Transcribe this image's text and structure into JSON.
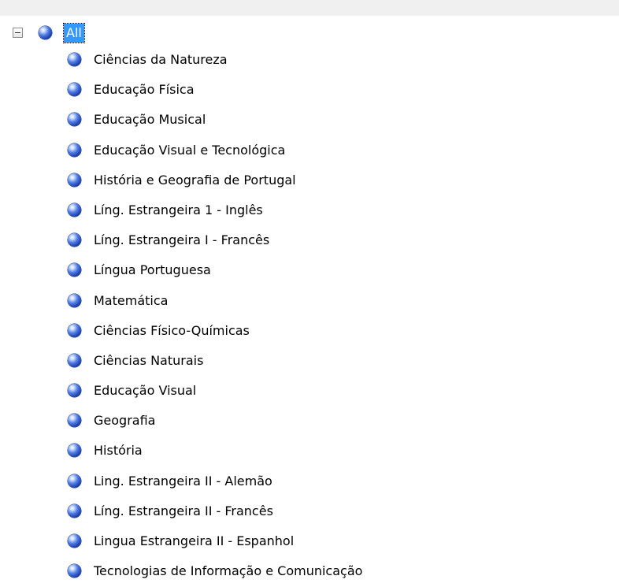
{
  "tree": {
    "root": {
      "label": "All",
      "expanded": true,
      "selected": true,
      "icon": "blue-sphere-icon"
    },
    "children": [
      {
        "label": "Ciências da Natureza",
        "icon": "blue-sphere-icon"
      },
      {
        "label": "Educação Física",
        "icon": "blue-sphere-icon"
      },
      {
        "label": "Educação Musical",
        "icon": "blue-sphere-icon"
      },
      {
        "label": "Educação Visual e Tecnológica",
        "icon": "blue-sphere-icon"
      },
      {
        "label": "História e Geografia de Portugal",
        "icon": "blue-sphere-icon"
      },
      {
        "label": "Líng. Estrangeira 1 - Inglês",
        "icon": "blue-sphere-icon"
      },
      {
        "label": "Líng. Estrangeira I - Francês",
        "icon": "blue-sphere-icon"
      },
      {
        "label": "Língua Portuguesa",
        "icon": "blue-sphere-icon"
      },
      {
        "label": "Matemática",
        "icon": "blue-sphere-icon"
      },
      {
        "label": "Ciências Físico-Químicas",
        "icon": "blue-sphere-icon"
      },
      {
        "label": "Ciências Naturais",
        "icon": "blue-sphere-icon"
      },
      {
        "label": "Educação Visual",
        "icon": "blue-sphere-icon"
      },
      {
        "label": "Geografia",
        "icon": "blue-sphere-icon"
      },
      {
        "label": "História",
        "icon": "blue-sphere-icon"
      },
      {
        "label": "Ling. Estrangeira II - Alemão",
        "icon": "blue-sphere-icon"
      },
      {
        "label": "Líng. Estrangeira II - Francês",
        "icon": "blue-sphere-icon"
      },
      {
        "label": "Lingua Estrangeira II - Espanhol",
        "icon": "blue-sphere-icon"
      },
      {
        "label": "Tecnologias de Informação e Comunicação",
        "icon": "blue-sphere-icon"
      }
    ]
  },
  "colors": {
    "selection_background": "#3399ff",
    "selection_text": "#ffffff",
    "header_band": "#f0f0f0",
    "sphere": "#2a50c8"
  }
}
